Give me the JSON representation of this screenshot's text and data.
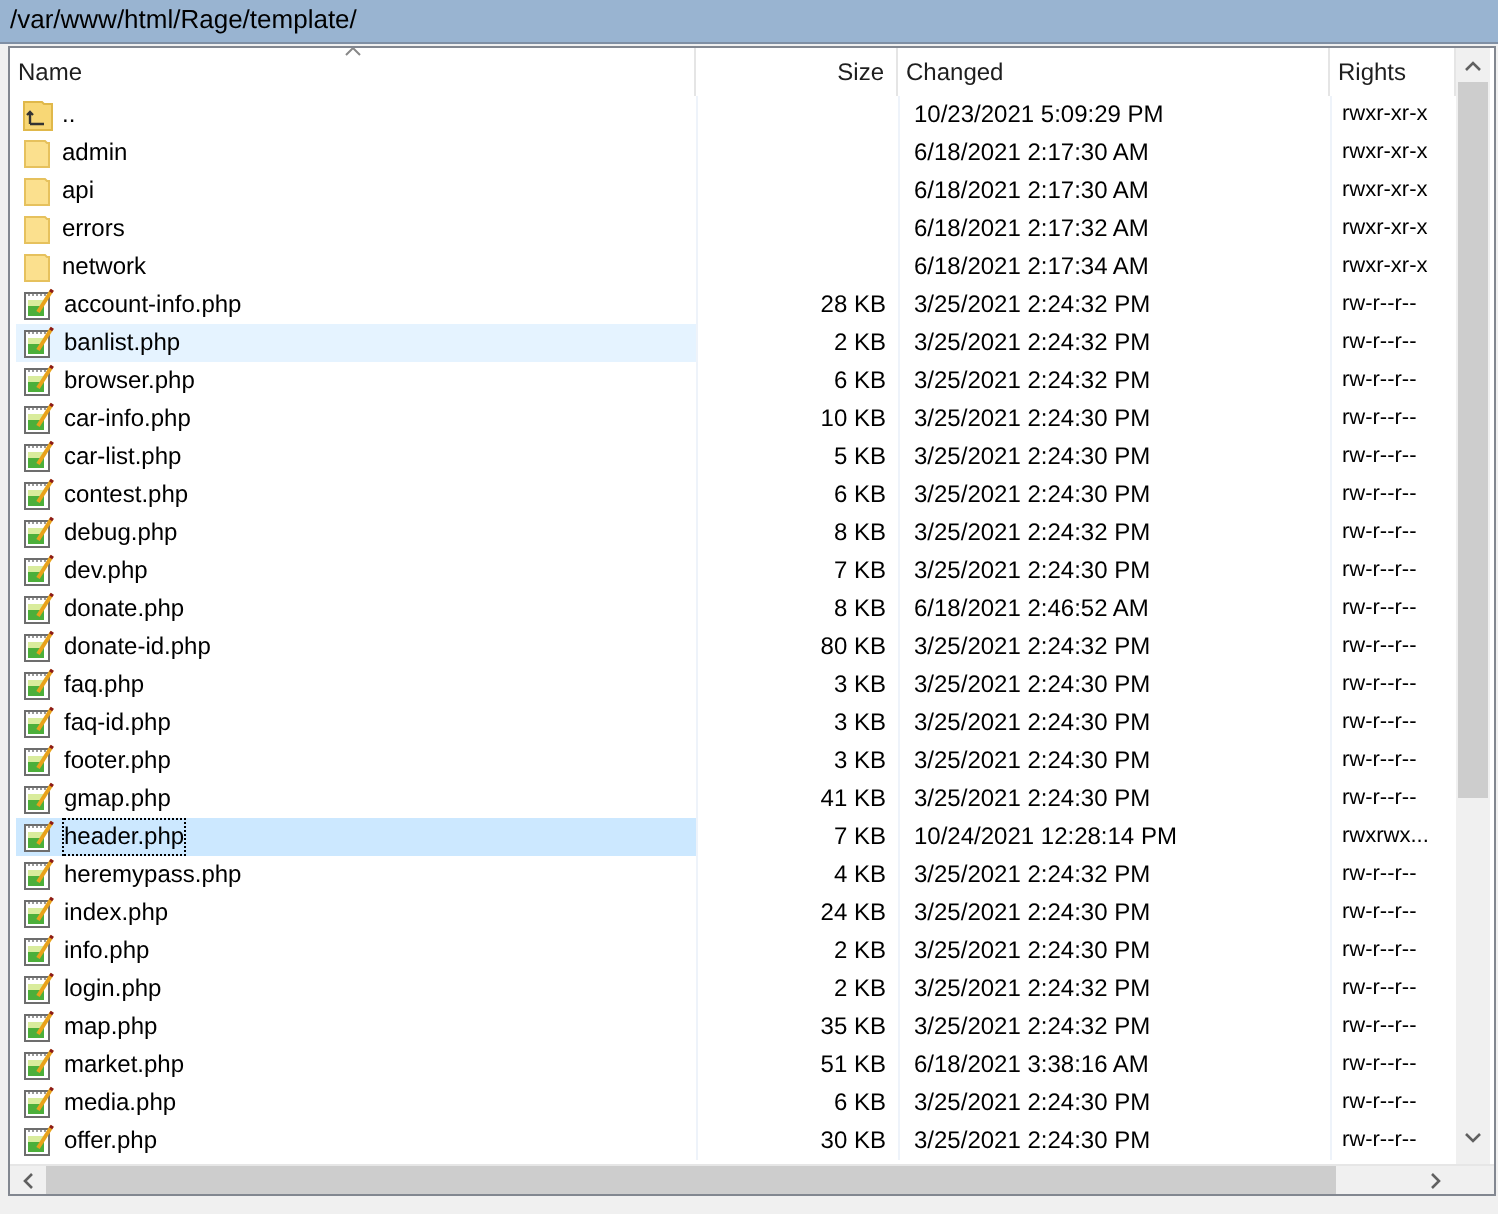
{
  "path_bar": {
    "path": "/var/www/html/Rage/template/"
  },
  "columns": [
    {
      "label": "Name",
      "sorted": true
    },
    {
      "label": "Size",
      "sorted": false
    },
    {
      "label": "Changed",
      "sorted": false
    },
    {
      "label": "Rights",
      "sorted": false
    }
  ],
  "rows": [
    {
      "kind": "parent",
      "name": "..",
      "changed": "10/23/2021 5:09:29 PM",
      "rights": "rwxr-xr-x",
      "selected": false,
      "hovered": false
    },
    {
      "kind": "folder",
      "name": "admin",
      "changed": "6/18/2021 2:17:30 AM",
      "rights": "rwxr-xr-x",
      "selected": false,
      "hovered": false
    },
    {
      "kind": "folder",
      "name": "api",
      "changed": "6/18/2021 2:17:30 AM",
      "rights": "rwxr-xr-x",
      "selected": false,
      "hovered": false
    },
    {
      "kind": "folder",
      "name": "errors",
      "changed": "6/18/2021 2:17:32 AM",
      "rights": "rwxr-xr-x",
      "selected": false,
      "hovered": false
    },
    {
      "kind": "folder",
      "name": "network",
      "changed": "6/18/2021 2:17:34 AM",
      "rights": "rwxr-xr-x",
      "selected": false,
      "hovered": false
    },
    {
      "kind": "file",
      "name": "account-info.php",
      "size": "28 KB",
      "changed": "3/25/2021 2:24:32 PM",
      "rights": "rw-r--r--",
      "selected": false,
      "hovered": false
    },
    {
      "kind": "file",
      "name": "banlist.php",
      "size": "2 KB",
      "changed": "3/25/2021 2:24:32 PM",
      "rights": "rw-r--r--",
      "selected": false,
      "hovered": true
    },
    {
      "kind": "file",
      "name": "browser.php",
      "size": "6 KB",
      "changed": "3/25/2021 2:24:32 PM",
      "rights": "rw-r--r--",
      "selected": false,
      "hovered": false
    },
    {
      "kind": "file",
      "name": "car-info.php",
      "size": "10 KB",
      "changed": "3/25/2021 2:24:30 PM",
      "rights": "rw-r--r--",
      "selected": false,
      "hovered": false
    },
    {
      "kind": "file",
      "name": "car-list.php",
      "size": "5 KB",
      "changed": "3/25/2021 2:24:30 PM",
      "rights": "rw-r--r--",
      "selected": false,
      "hovered": false
    },
    {
      "kind": "file",
      "name": "contest.php",
      "size": "6 KB",
      "changed": "3/25/2021 2:24:30 PM",
      "rights": "rw-r--r--",
      "selected": false,
      "hovered": false
    },
    {
      "kind": "file",
      "name": "debug.php",
      "size": "8 KB",
      "changed": "3/25/2021 2:24:32 PM",
      "rights": "rw-r--r--",
      "selected": false,
      "hovered": false
    },
    {
      "kind": "file",
      "name": "dev.php",
      "size": "7 KB",
      "changed": "3/25/2021 2:24:30 PM",
      "rights": "rw-r--r--",
      "selected": false,
      "hovered": false
    },
    {
      "kind": "file",
      "name": "donate.php",
      "size": "8 KB",
      "changed": "6/18/2021 2:46:52 AM",
      "rights": "rw-r--r--",
      "selected": false,
      "hovered": false
    },
    {
      "kind": "file",
      "name": "donate-id.php",
      "size": "80 KB",
      "changed": "3/25/2021 2:24:32 PM",
      "rights": "rw-r--r--",
      "selected": false,
      "hovered": false
    },
    {
      "kind": "file",
      "name": "faq.php",
      "size": "3 KB",
      "changed": "3/25/2021 2:24:30 PM",
      "rights": "rw-r--r--",
      "selected": false,
      "hovered": false
    },
    {
      "kind": "file",
      "name": "faq-id.php",
      "size": "3 KB",
      "changed": "3/25/2021 2:24:30 PM",
      "rights": "rw-r--r--",
      "selected": false,
      "hovered": false
    },
    {
      "kind": "file",
      "name": "footer.php",
      "size": "3 KB",
      "changed": "3/25/2021 2:24:30 PM",
      "rights": "rw-r--r--",
      "selected": false,
      "hovered": false
    },
    {
      "kind": "file",
      "name": "gmap.php",
      "size": "41 KB",
      "changed": "3/25/2021 2:24:30 PM",
      "rights": "rw-r--r--",
      "selected": false,
      "hovered": false
    },
    {
      "kind": "file",
      "name": "header.php",
      "size": "7 KB",
      "changed": "10/24/2021 12:28:14 PM",
      "rights": "rwxrwx...",
      "selected": true,
      "hovered": false
    },
    {
      "kind": "file",
      "name": "heremypass.php",
      "size": "4 KB",
      "changed": "3/25/2021 2:24:32 PM",
      "rights": "rw-r--r--",
      "selected": false,
      "hovered": false
    },
    {
      "kind": "file",
      "name": "index.php",
      "size": "24 KB",
      "changed": "3/25/2021 2:24:30 PM",
      "rights": "rw-r--r--",
      "selected": false,
      "hovered": false
    },
    {
      "kind": "file",
      "name": "info.php",
      "size": "2 KB",
      "changed": "3/25/2021 2:24:30 PM",
      "rights": "rw-r--r--",
      "selected": false,
      "hovered": false
    },
    {
      "kind": "file",
      "name": "login.php",
      "size": "2 KB",
      "changed": "3/25/2021 2:24:32 PM",
      "rights": "rw-r--r--",
      "selected": false,
      "hovered": false
    },
    {
      "kind": "file",
      "name": "map.php",
      "size": "35 KB",
      "changed": "3/25/2021 2:24:32 PM",
      "rights": "rw-r--r--",
      "selected": false,
      "hovered": false
    },
    {
      "kind": "file",
      "name": "market.php",
      "size": "51 KB",
      "changed": "6/18/2021 3:38:16 AM",
      "rights": "rw-r--r--",
      "selected": false,
      "hovered": false
    },
    {
      "kind": "file",
      "name": "media.php",
      "size": "6 KB",
      "changed": "3/25/2021 2:24:30 PM",
      "rights": "rw-r--r--",
      "selected": false,
      "hovered": false
    },
    {
      "kind": "file",
      "name": "offer.php",
      "size": "30 KB",
      "changed": "3/25/2021 2:24:30 PM",
      "rights": "rw-r--r--",
      "selected": false,
      "hovered": false
    }
  ]
}
